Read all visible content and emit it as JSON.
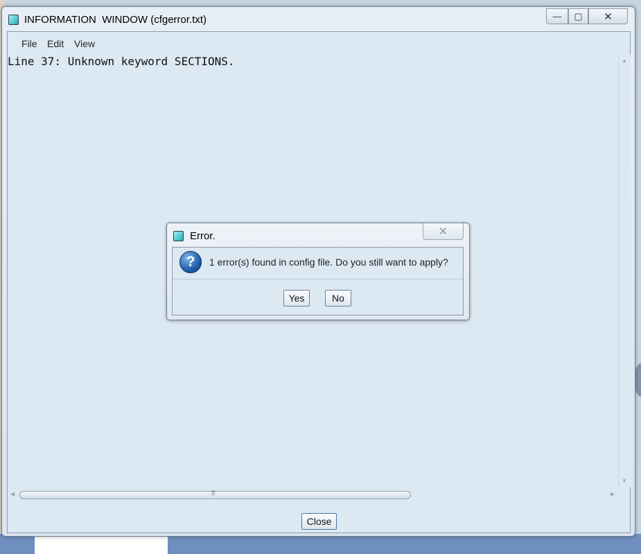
{
  "window": {
    "title": "INFORMATION  WINDOW (cfgerror.txt)",
    "caption": {
      "minimize": "—",
      "maximize": "▢",
      "close": "✕"
    }
  },
  "menu": {
    "items": [
      {
        "label": "File"
      },
      {
        "label": "Edit"
      },
      {
        "label": "View"
      }
    ]
  },
  "content": {
    "lines": [
      "Line 37: Unknown keyword SECTIONS."
    ]
  },
  "scroll": {
    "grip": "⁞⁞⁞",
    "up": "▲",
    "down": "▼",
    "left": "◀",
    "right": "▶"
  },
  "footer": {
    "close_label": "Close"
  },
  "dialog": {
    "title": "Error.",
    "close_glyph": "✕",
    "icon": "question-icon",
    "icon_glyph": "?",
    "message": "1 error(s) found in config file. Do you still want to apply?",
    "yes_label": "Yes",
    "no_label": "No"
  }
}
